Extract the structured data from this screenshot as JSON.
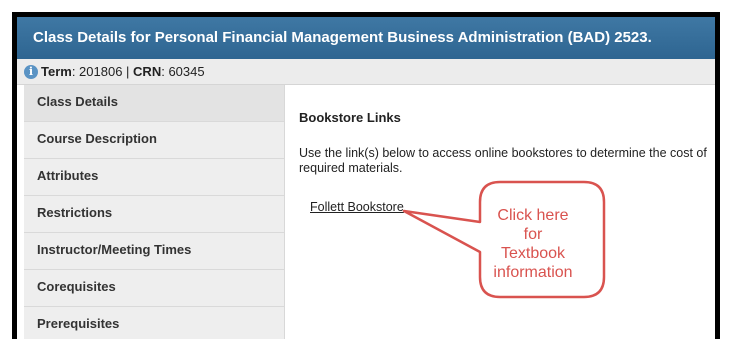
{
  "window": {
    "title": "Class Details for Personal Financial Management Business Administration (BAD) 2523."
  },
  "term_bar": {
    "term_label": "Term",
    "term_value": ": 201806 | ",
    "crn_label": "CRN",
    "crn_value": ": 60345",
    "icon": "info-icon"
  },
  "sidebar": {
    "items": [
      {
        "label": "Class Details"
      },
      {
        "label": "Course Description"
      },
      {
        "label": "Attributes"
      },
      {
        "label": "Restrictions"
      },
      {
        "label": "Instructor/Meeting Times"
      },
      {
        "label": "Corequisites"
      },
      {
        "label": "Prerequisites"
      }
    ]
  },
  "main": {
    "heading": "Bookstore Links",
    "description": "Use the link(s) below to access online bookstores to determine the cost of required materials.",
    "link_label": "Follett Bookstore"
  },
  "callout": {
    "lines": [
      "Click here",
      "for",
      "Textbook",
      "information"
    ],
    "color": "#d9534f"
  },
  "colors": {
    "title_bar": "#2e6591",
    "sidebar_bg": "#eeeeee",
    "accent_red": "#d9534f"
  }
}
